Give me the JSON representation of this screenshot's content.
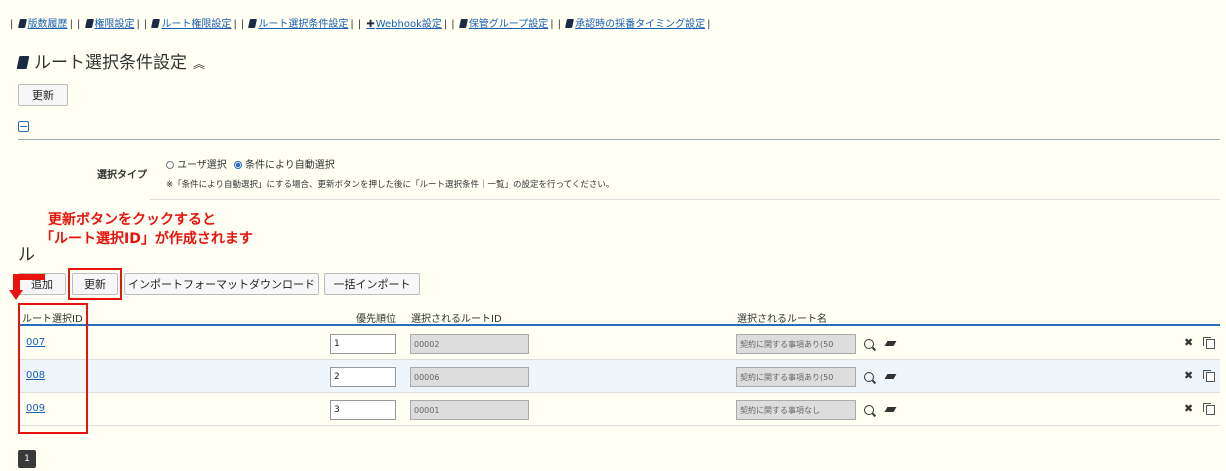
{
  "nav": {
    "items": [
      {
        "label": "版数履歴",
        "icon": "book"
      },
      {
        "label": "権限設定",
        "icon": "book"
      },
      {
        "label": "ルート権限設定",
        "icon": "book"
      },
      {
        "label": "ルート選択条件設定",
        "icon": "book"
      },
      {
        "label": "Webhook設定",
        "icon": "plus"
      },
      {
        "label": "保管グループ設定",
        "icon": "book"
      },
      {
        "label": "承認時の採番タイミング設定",
        "icon": "book"
      }
    ]
  },
  "page": {
    "title": "ルート選択条件設定",
    "title_chevron": "≈",
    "update_button": "更新"
  },
  "settings": {
    "type_label": "選択タイプ",
    "options": [
      {
        "label": "ユーザ選択",
        "selected": false
      },
      {
        "label": "条件により自動選択",
        "selected": true
      }
    ],
    "note": "※「条件により自動選択」にする場合、更新ボタンを押した後に「ルート選択条件｜一覧」の設定を行ってください。"
  },
  "annotation": {
    "line1": "更新ボタンをクックすると",
    "line2": "「ルート選択ID」が作成されます",
    "color": "#e8130e"
  },
  "list": {
    "section_title_fragment": "ル",
    "toolbar": {
      "add": "追加",
      "update": "更新",
      "download": "インポートフォーマットダウンロード",
      "import": "一括インポート"
    },
    "headers": {
      "id": "ルート選択ID",
      "priority": "優先順位",
      "route_id": "選択されるルートID",
      "route_name": "選択されるルート名"
    },
    "rows": [
      {
        "id": "007",
        "priority": "1",
        "route_id": "00002",
        "route_name": "契約に関する事項あり(50"
      },
      {
        "id": "008",
        "priority": "2",
        "route_id": "00006",
        "route_name": "契約に関する事項あり(50"
      },
      {
        "id": "009",
        "priority": "3",
        "route_id": "00001",
        "route_name": "契約に関する事項なし"
      }
    ],
    "row_actions": {
      "delete_glyph": "✖"
    }
  },
  "pagination": {
    "current": "1"
  },
  "colors": {
    "accent": "#2a6ebb",
    "highlight": "#e8130e",
    "background": "#fffff4"
  }
}
